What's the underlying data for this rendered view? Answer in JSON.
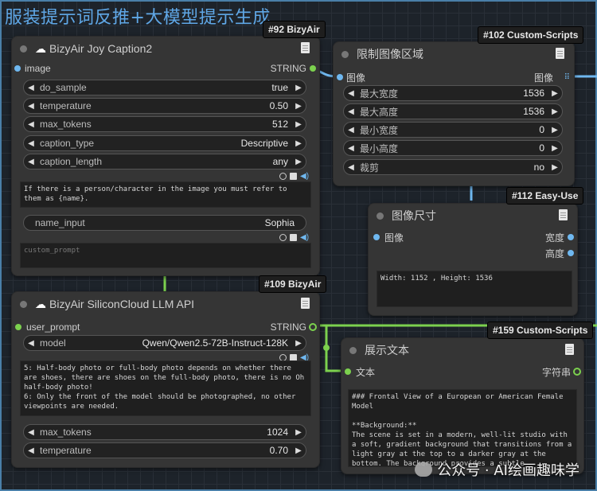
{
  "group_title": "服装提示词反推+大模型提示生成",
  "watermark": "公众号 · AI绘画趣味学",
  "nodes": {
    "joy": {
      "badge": "#92 BizyAir",
      "title": "BizyAir Joy Caption2",
      "input": "image",
      "output": "STRING",
      "widgets": [
        {
          "label": "do_sample",
          "value": "true"
        },
        {
          "label": "temperature",
          "value": "0.50"
        },
        {
          "label": "max_tokens",
          "value": "512"
        },
        {
          "label": "caption_type",
          "value": "Descriptive"
        },
        {
          "label": "caption_length",
          "value": "any"
        }
      ],
      "prompt_text": "If there is a person/character in the image you must refer to them as {name}.",
      "name_input": {
        "label": "name_input",
        "value": "Sophia"
      },
      "custom_prompt_placeholder": "custom_prompt"
    },
    "limit": {
      "badge": "#102 Custom-Scripts",
      "title": "限制图像区域",
      "input": "图像",
      "output": "图像",
      "widgets": [
        {
          "label": "最大宽度",
          "value": "1536"
        },
        {
          "label": "最大高度",
          "value": "1536"
        },
        {
          "label": "最小宽度",
          "value": "0"
        },
        {
          "label": "最小高度",
          "value": "0"
        },
        {
          "label": "裁剪",
          "value": "no"
        }
      ]
    },
    "size": {
      "badge": "#112 Easy-Use",
      "title": "图像尺寸",
      "input": "图像",
      "out_w": "宽度",
      "out_h": "高度",
      "text": "Width: 1152 , Height: 1536"
    },
    "llm": {
      "badge": "#109 BizyAir",
      "title": "BizyAir SiliconCloud LLM API",
      "input": "user_prompt",
      "output": "STRING",
      "model": {
        "label": "model",
        "value": "Qwen/Qwen2.5-72B-Instruct-128K"
      },
      "text": "5: Half-body photo or full-body photo depends on whether there are shoes, there are shoes on the full-body photo, there is no Oh half-body photo!\n6: Only the front of the model should be photographed, no other viewpoints are needed.",
      "widgets": [
        {
          "label": "max_tokens",
          "value": "1024"
        },
        {
          "label": "temperature",
          "value": "0.70"
        }
      ]
    },
    "show": {
      "badge": "#159 Custom-Scripts",
      "title": "展示文本",
      "input": "文本",
      "output": "字符串",
      "text": "### Frontal View of a European or American Female Model\n\n**Background:**\nThe scene is set in a modern, well-lit studio with a soft, gradient background that transitions from a light gray at the top to a darker gray at the bottom. The background provides a subtle"
    }
  }
}
